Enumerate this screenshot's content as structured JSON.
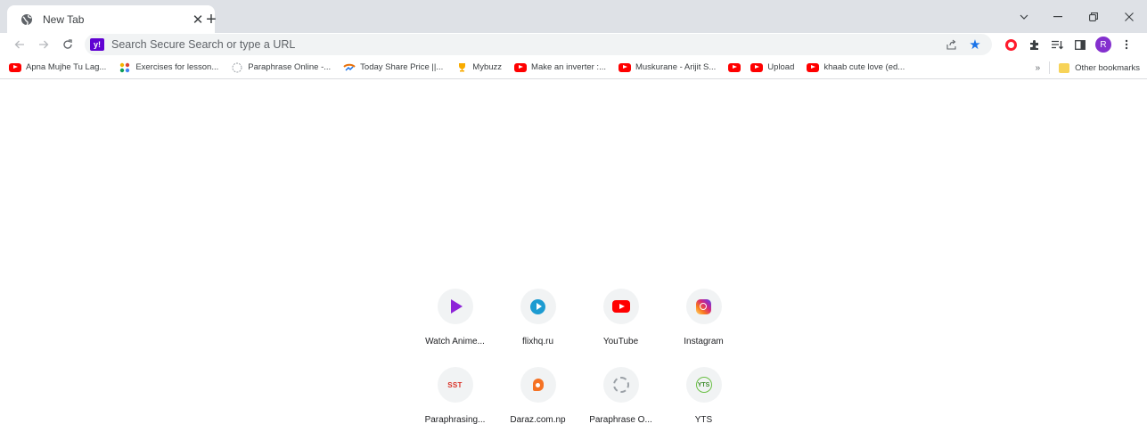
{
  "window": {
    "tab": {
      "title": "New Tab",
      "favicon": "globe-icon"
    },
    "controls": [
      "chevron-down-icon",
      "minimize-icon",
      "restore-icon",
      "close-icon"
    ]
  },
  "toolbar": {
    "omnibox_placeholder": "Search Secure Search or type a URL",
    "profile_initial": "R"
  },
  "bookmarks": {
    "items": [
      {
        "label": "Apna Mujhe Tu Lag...",
        "icon": "youtube-icon"
      },
      {
        "label": "Exercises for lesson...",
        "icon": "pinwheel-icon"
      },
      {
        "label": "Paraphrase Online -...",
        "icon": "paraphrase-icon"
      },
      {
        "label": "Today Share Price ||...",
        "icon": "share-price-icon"
      },
      {
        "label": "Mybuzz",
        "icon": "trophy-icon"
      },
      {
        "label": "Make an inverter :...",
        "icon": "youtube-icon"
      },
      {
        "label": "Muskurane - Arijit S...",
        "icon": "youtube-icon"
      },
      {
        "label": "",
        "icon": "youtube-icon"
      },
      {
        "label": "Upload",
        "icon": "youtube-icon"
      },
      {
        "label": "khaab cute love (ed...",
        "icon": "youtube-icon"
      }
    ],
    "overflow": "»",
    "other": "Other bookmarks"
  },
  "shortcuts": [
    {
      "label": "Watch Anime...",
      "icon": "play-icon"
    },
    {
      "label": "flixhq.ru",
      "icon": "flixhq-icon"
    },
    {
      "label": "YouTube",
      "icon": "youtube-icon"
    },
    {
      "label": "Instagram",
      "icon": "instagram-icon"
    },
    {
      "label": "Paraphrasing...",
      "icon": "sst-icon",
      "icon_text": "SST"
    },
    {
      "label": "Daraz.com.np",
      "icon": "daraz-icon"
    },
    {
      "label": "Paraphrase O...",
      "icon": "paraphrase-icon"
    },
    {
      "label": "YTS",
      "icon": "yts-icon",
      "icon_text": "YTS"
    }
  ]
}
